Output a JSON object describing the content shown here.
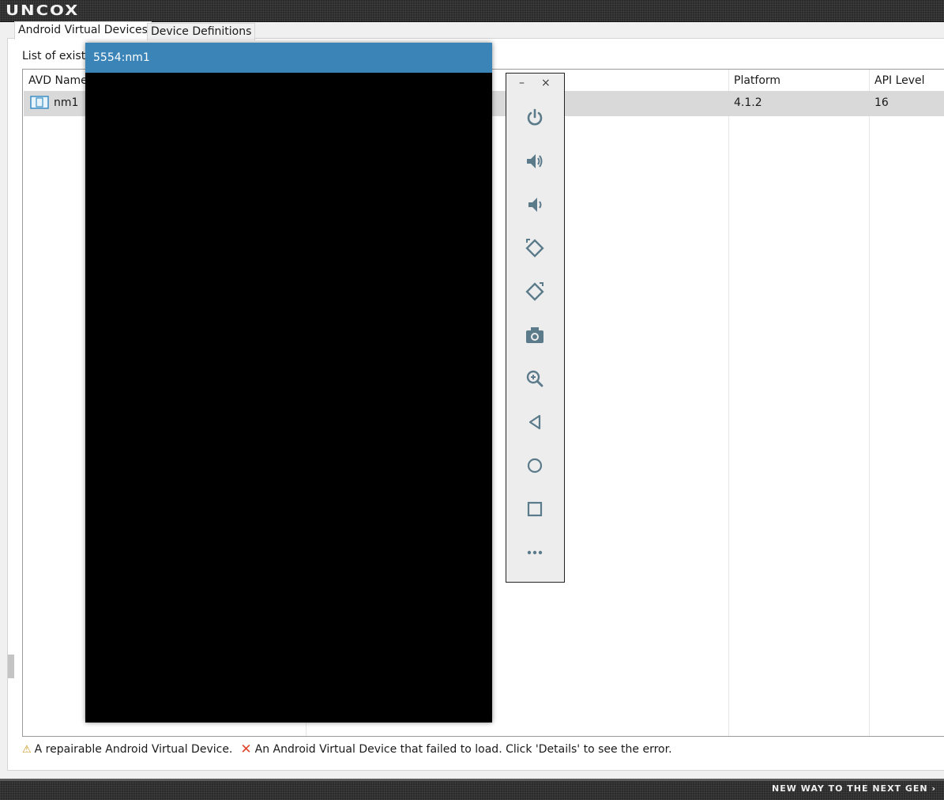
{
  "brand": {
    "logo_text": "UNCOX",
    "tagline": "NEW WAY TO THE NEXT GEN ›"
  },
  "tabs": [
    {
      "label": "Android Virtual Devices",
      "active": true
    },
    {
      "label": "Device Definitions",
      "active": false
    }
  ],
  "list_label": "List of existi",
  "table": {
    "columns": [
      "AVD Name",
      "Platform",
      "API Level"
    ],
    "rows": [
      {
        "name": "nm1",
        "platform": "4.1.2",
        "api_level": "16",
        "icon": "avd-device-icon"
      }
    ]
  },
  "legend": {
    "repairable": "A repairable Android Virtual Device.",
    "failed": "An Android Virtual Device that failed to load. Click 'Details' to see the error."
  },
  "emulator": {
    "title": "5554:nm1",
    "toolbar": {
      "minimize": "–",
      "close": "×",
      "buttons": [
        "power-icon",
        "volume-up-icon",
        "volume-down-icon",
        "rotate-left-icon",
        "rotate-right-icon",
        "camera-icon",
        "zoom-icon",
        "back-icon",
        "home-icon",
        "overview-icon",
        "more-icon"
      ]
    }
  },
  "colors": {
    "title_bar": "#3a84b8",
    "selected_row": "#d9d9d9",
    "toolbar_icon": "#5b7a8a"
  }
}
